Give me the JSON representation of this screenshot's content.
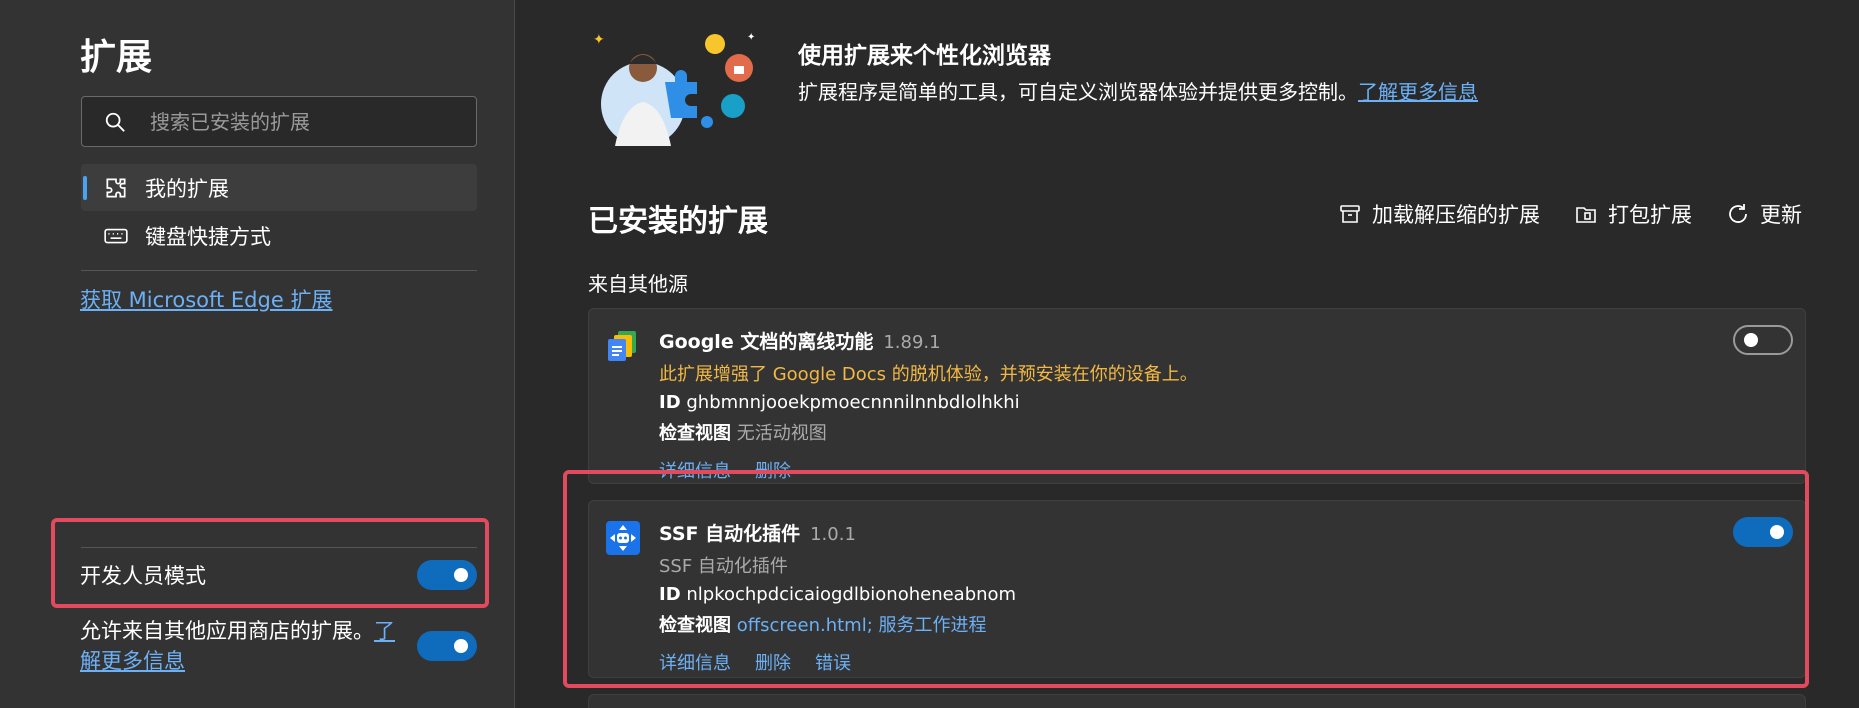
{
  "sidebar": {
    "title": "扩展",
    "search_placeholder": "搜索已安装的扩展",
    "nav": [
      {
        "label": "我的扩展",
        "icon": "puzzle-icon",
        "active": true
      },
      {
        "label": "键盘快捷方式",
        "icon": "keyboard-icon",
        "active": false
      }
    ],
    "store_link": "获取 Microsoft Edge 扩展",
    "developer_mode": {
      "label": "开发人员模式",
      "enabled": true
    },
    "allow_other_stores": {
      "text": "允许来自其他应用商店的扩展。",
      "link": "了解更多信息",
      "enabled": true
    }
  },
  "hero": {
    "title": "使用扩展来个性化浏览器",
    "description": "扩展程序是简单的工具，可自定义浏览器体验并提供更多控制。",
    "link": "了解更多信息"
  },
  "installed": {
    "title": "已安装的扩展",
    "toolbar": [
      {
        "label": "加载解压缩的扩展",
        "icon": "archive-box-icon"
      },
      {
        "label": "打包扩展",
        "icon": "package-icon"
      },
      {
        "label": "更新",
        "icon": "refresh-icon"
      }
    ],
    "source_label": "来自其他源",
    "extensions": [
      {
        "name": "Google 文档的离线功能",
        "version": "1.89.1",
        "description": "此扩展增强了 Google Docs 的脱机体验，并预安装在你的设备上。",
        "id_label": "ID",
        "id": "ghbmnnjooekpmoecnnnilnnbdlolhkhi",
        "inspect_label": "检查视图",
        "inspect_value": "无活动视图",
        "actions": [
          "详细信息",
          "删除"
        ],
        "enabled": false
      },
      {
        "name": "SSF 自动化插件",
        "version": "1.0.1",
        "description": "SSF 自动化插件",
        "id_label": "ID",
        "id": "nlpkochpdcicaiogdlbionoheneabnom",
        "inspect_label": "检查视图",
        "inspect_value": "offscreen.html; 服务工作进程",
        "actions": [
          "详细信息",
          "删除",
          "错误"
        ],
        "enabled": true
      }
    ]
  },
  "colors": {
    "accent": "#0f6cbd",
    "link": "#6cb0f5",
    "highlight": "#e24a5e",
    "warning": "#f2b845"
  }
}
